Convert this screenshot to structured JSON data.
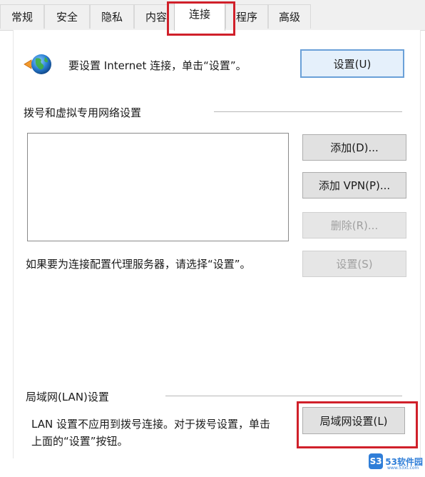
{
  "tabs": [
    {
      "label": "常规"
    },
    {
      "label": "安全"
    },
    {
      "label": "隐私"
    },
    {
      "label": "内容"
    },
    {
      "label": "连接"
    },
    {
      "label": "程序"
    },
    {
      "label": "高级"
    }
  ],
  "active_tab": "连接",
  "internet": {
    "text": "要设置 Internet 连接，单击“设置”。",
    "setup_button": "设置(U)",
    "icon": "globe-icon"
  },
  "dialup": {
    "heading": "拨号和虚拟专用网络设置",
    "add_button": "添加(D)...",
    "add_vpn_button": "添加 VPN(P)...",
    "remove_button": "删除(R)...",
    "settings_button": "设置(S)",
    "proxy_hint": "如果要为连接配置代理服务器，请选择“设置”。"
  },
  "lan": {
    "heading": "局域网(LAN)设置",
    "desc_line1": "LAN 设置不应用到拨号连接。对于拨号设置，单击",
    "desc_line2": "上面的“设置”按钮。",
    "lan_button": "局域网设置(L)"
  },
  "watermark": {
    "badge": "S3",
    "text": "53软件园",
    "sub": "www.53xt.com"
  },
  "colors": {
    "highlight": "#d0202a",
    "default_button_border": "#6aa0d8",
    "watermark": "#2f7ed8"
  }
}
